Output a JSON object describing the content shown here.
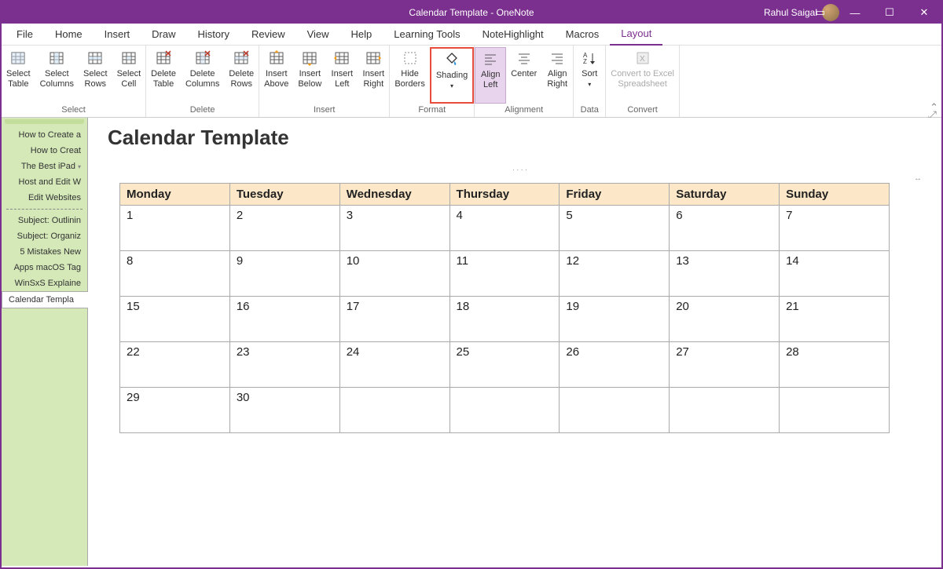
{
  "titlebar": {
    "title": "Calendar Template  -  OneNote",
    "user": "Rahul Saigal"
  },
  "ribbon_tabs": [
    "File",
    "Home",
    "Insert",
    "Draw",
    "History",
    "Review",
    "View",
    "Help",
    "Learning Tools",
    "NoteHighlight",
    "Macros",
    "Layout"
  ],
  "ribbon_active": "Layout",
  "ribbon_groups": {
    "select": {
      "label": "Select",
      "buttons": [
        {
          "id": "select-table",
          "line1": "Select",
          "line2": "Table"
        },
        {
          "id": "select-columns",
          "line1": "Select",
          "line2": "Columns"
        },
        {
          "id": "select-rows",
          "line1": "Select",
          "line2": "Rows"
        },
        {
          "id": "select-cell",
          "line1": "Select",
          "line2": "Cell"
        }
      ]
    },
    "delete": {
      "label": "Delete",
      "buttons": [
        {
          "id": "delete-table",
          "line1": "Delete",
          "line2": "Table"
        },
        {
          "id": "delete-columns",
          "line1": "Delete",
          "line2": "Columns"
        },
        {
          "id": "delete-rows",
          "line1": "Delete",
          "line2": "Rows"
        }
      ]
    },
    "insert": {
      "label": "Insert",
      "buttons": [
        {
          "id": "insert-above",
          "line1": "Insert",
          "line2": "Above"
        },
        {
          "id": "insert-below",
          "line1": "Insert",
          "line2": "Below"
        },
        {
          "id": "insert-left",
          "line1": "Insert",
          "line2": "Left"
        },
        {
          "id": "insert-right",
          "line1": "Insert",
          "line2": "Right"
        }
      ]
    },
    "format": {
      "label": "Format",
      "buttons": [
        {
          "id": "hide-borders",
          "line1": "Hide",
          "line2": "Borders"
        },
        {
          "id": "shading",
          "line1": "Shading",
          "line2": "",
          "dropdown": true,
          "highlighted": true
        }
      ]
    },
    "alignment": {
      "label": "Alignment",
      "buttons": [
        {
          "id": "align-left",
          "line1": "Align",
          "line2": "Left",
          "selected": true
        },
        {
          "id": "center",
          "line1": "Center",
          "line2": ""
        },
        {
          "id": "align-right",
          "line1": "Align",
          "line2": "Right"
        }
      ]
    },
    "data": {
      "label": "Data",
      "buttons": [
        {
          "id": "sort",
          "line1": "Sort",
          "line2": "",
          "dropdown": true
        }
      ]
    },
    "convert": {
      "label": "Convert",
      "buttons": [
        {
          "id": "convert-excel",
          "line1": "Convert to Excel",
          "line2": "Spreadsheet",
          "disabled": true
        }
      ]
    }
  },
  "sidebar": {
    "items": [
      {
        "label": "How to Create a"
      },
      {
        "label": "How to Creat"
      },
      {
        "label": "The Best iPad",
        "arrow": true
      },
      {
        "label": "Host and Edit W"
      },
      {
        "label": "Edit Websites"
      }
    ],
    "items2": [
      {
        "label": "Subject: Outlinin"
      },
      {
        "label": "Subject: Organiz"
      },
      {
        "label": "5 Mistakes New"
      },
      {
        "label": "Apps macOS Tag"
      },
      {
        "label": "WinSxS Explaine"
      },
      {
        "label": "Calendar Templa",
        "active": true
      }
    ]
  },
  "page": {
    "title": "Calendar Template"
  },
  "calendar": {
    "headers": [
      "Monday",
      "Tuesday",
      "Wednesday",
      "Thursday",
      "Friday",
      "Saturday",
      "Sunday"
    ],
    "rows": [
      [
        "1",
        "2",
        "3",
        "4",
        "5",
        "6",
        "7"
      ],
      [
        "8",
        "9",
        "10",
        "11",
        "12",
        "13",
        "14"
      ],
      [
        "15",
        "16",
        "17",
        "18",
        "19",
        "20",
        "21"
      ],
      [
        "22",
        "23",
        "24",
        "25",
        "26",
        "27",
        "28"
      ],
      [
        "29",
        "30",
        "",
        "",
        "",
        "",
        ""
      ]
    ]
  }
}
